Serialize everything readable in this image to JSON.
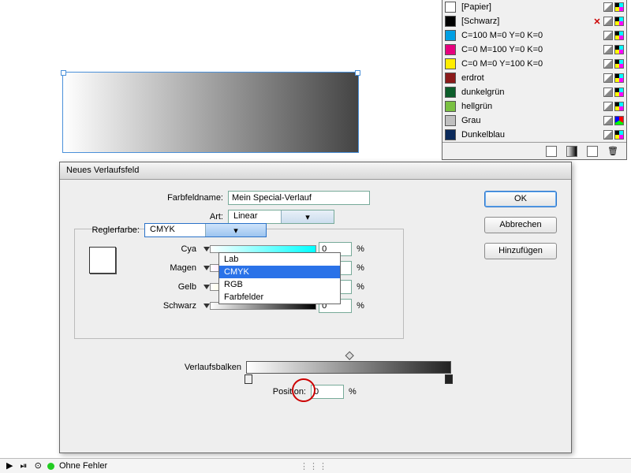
{
  "swatches": {
    "items": [
      {
        "label": "[Papier]",
        "color": "#ffffff",
        "none": false
      },
      {
        "label": "[Schwarz]",
        "color": "#000000",
        "none": true
      },
      {
        "label": "C=100 M=0 Y=0 K=0",
        "color": "#009fe3"
      },
      {
        "label": "C=0 M=100 Y=0 K=0",
        "color": "#e6007e"
      },
      {
        "label": "C=0 M=0 Y=100 K=0",
        "color": "#ffed00"
      },
      {
        "label": "erdrot",
        "color": "#8b1a1a"
      },
      {
        "label": "dunkelgrün",
        "color": "#0b5d2a"
      },
      {
        "label": "hellgrün",
        "color": "#7ac142"
      },
      {
        "label": "Grau",
        "color": "#bfbfbf"
      },
      {
        "label": "Dunkelblau",
        "color": "#0b2a5b"
      }
    ]
  },
  "dialog": {
    "title": "Neues Verlaufsfeld",
    "name_label": "Farbfeldname:",
    "name_value": "Mein Special-Verlauf",
    "art_label": "Art:",
    "art_value": "Linear",
    "reglerfarbe_label": "Reglerfarbe:",
    "reglerfarbe_value": "CMYK",
    "dd": [
      "Lab",
      "CMYK",
      "RGB",
      "Farbfelder"
    ],
    "cyan_label": "Cya",
    "cyan_value": "0",
    "magenta_label": "Magen",
    "magenta_value": "0",
    "gelb_label": "Gelb",
    "gelb_value": "0",
    "schwarz_label": "Schwarz",
    "schwarz_value": "0",
    "pct": "%",
    "verlaufsbalken_label": "Verlaufsbalken",
    "position_label": "Position:",
    "position_value": "0",
    "ok": "OK",
    "cancel": "Abbrechen",
    "add": "Hinzufügen"
  },
  "status": {
    "text": "Ohne Fehler"
  }
}
